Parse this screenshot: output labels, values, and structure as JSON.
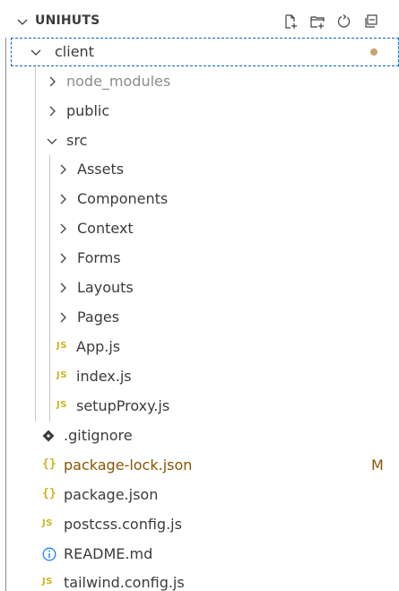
{
  "explorer": {
    "title": "UNIHUTS",
    "actions": [
      {
        "name": "new-file-icon"
      },
      {
        "name": "new-folder-icon"
      },
      {
        "name": "refresh-icon"
      },
      {
        "name": "collapse-all-icon"
      }
    ]
  },
  "tree": {
    "client": {
      "label": "client"
    },
    "node_modules": {
      "label": "node_modules"
    },
    "public": {
      "label": "public"
    },
    "src": {
      "label": "src"
    },
    "assets": {
      "label": "Assets"
    },
    "components": {
      "label": "Components"
    },
    "context": {
      "label": "Context"
    },
    "forms": {
      "label": "Forms"
    },
    "layouts": {
      "label": "Layouts"
    },
    "pages": {
      "label": "Pages"
    },
    "app_js": {
      "label": "App.js",
      "icon_text": "JS"
    },
    "index_js": {
      "label": "index.js",
      "icon_text": "JS"
    },
    "setup_proxy": {
      "label": "setupProxy.js",
      "icon_text": "JS"
    },
    "gitignore": {
      "label": ".gitignore"
    },
    "package_lock": {
      "label": "package-lock.json",
      "icon_text": "{}",
      "status": "M"
    },
    "package_json": {
      "label": "package.json",
      "icon_text": "{}"
    },
    "postcss": {
      "label": "postcss.config.js",
      "icon_text": "JS"
    },
    "readme": {
      "label": "README.md"
    },
    "tailwind": {
      "label": "tailwind.config.js",
      "icon_text": "JS"
    }
  },
  "colors": {
    "text": "#3b3b3b",
    "ignored_text": "#8c8c8c",
    "modified_text": "#895503",
    "js_icon": "#cbb41f",
    "info_icon": "#1a85ff",
    "focus_outline": "#0e66c7"
  }
}
